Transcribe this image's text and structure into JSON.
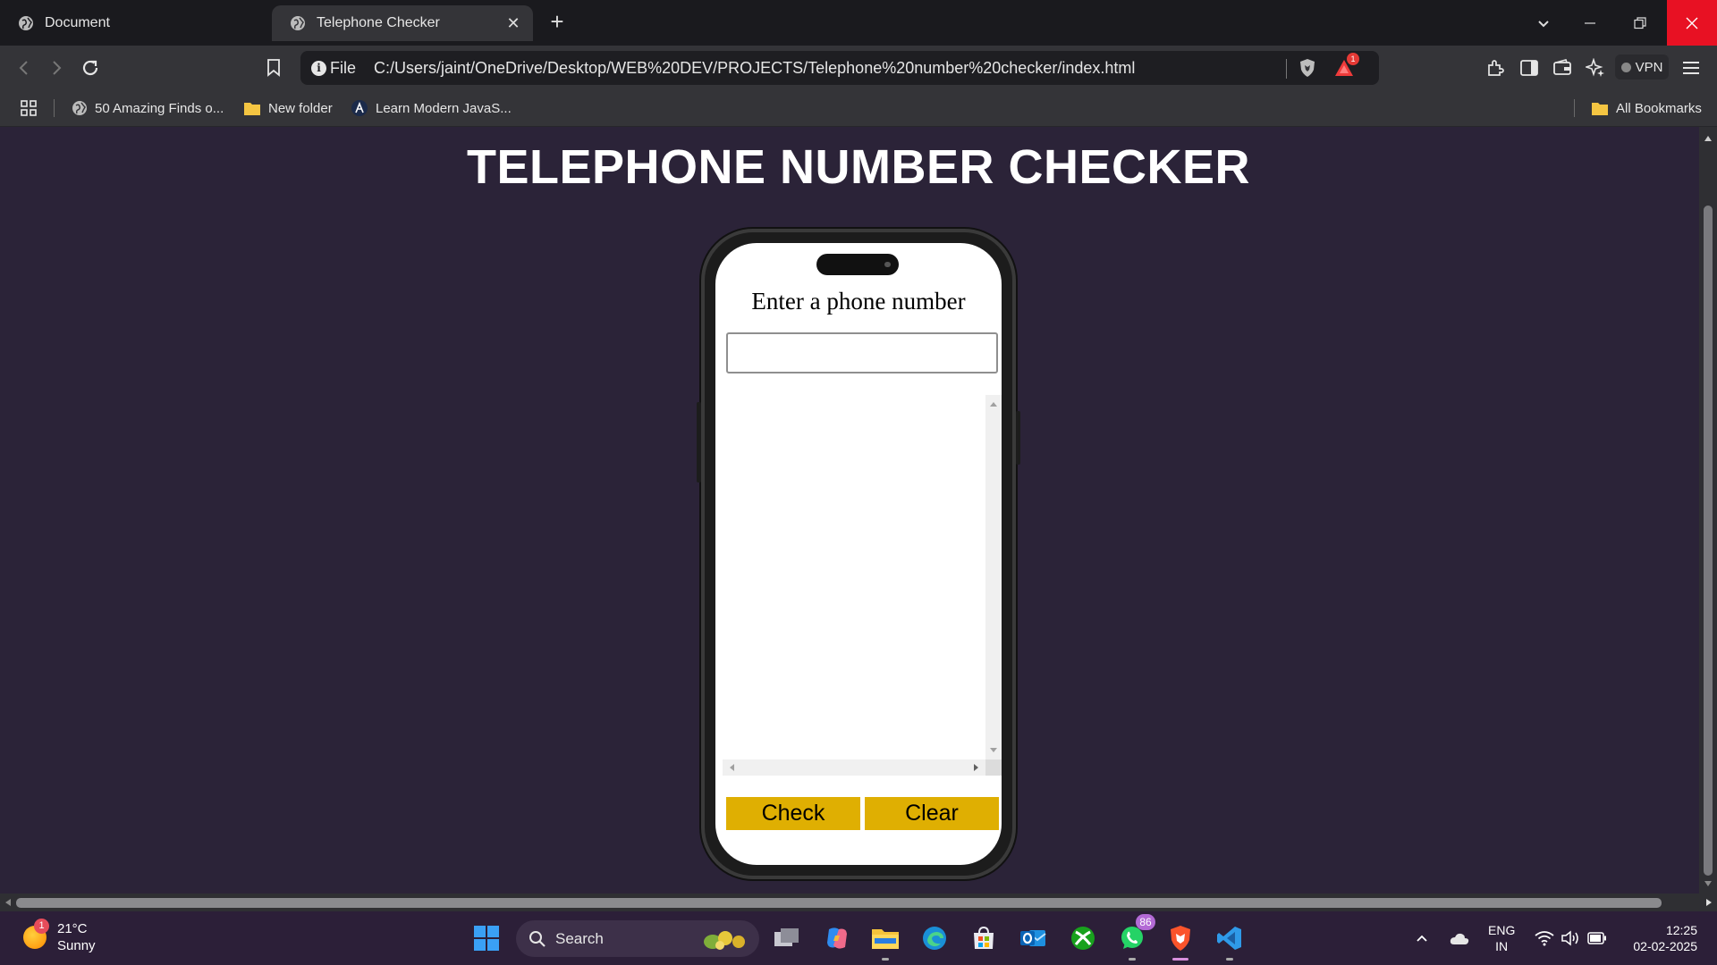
{
  "browser": {
    "tabs": [
      {
        "title": "Document",
        "active": false
      },
      {
        "title": "Telephone Checker",
        "active": true
      }
    ],
    "address": {
      "scheme_label": "File",
      "url": "C:/Users/jaint/OneDrive/Desktop/WEB%20DEV/PROJECTS/Telephone%20number%20checker/index.html"
    },
    "alerts_badge": "1",
    "vpn_label": "VPN",
    "bookmarks": [
      {
        "label": "50 Amazing Finds o...",
        "icon": "globe-icon"
      },
      {
        "label": "New folder",
        "icon": "folder-icon"
      },
      {
        "label": "Learn Modern JavaS...",
        "icon": "site-icon"
      }
    ],
    "all_bookmarks_label": "All Bookmarks"
  },
  "page": {
    "title": "TELEPHONE NUMBER CHECKER",
    "input_label": "Enter a phone number",
    "input_value": "",
    "check_button": "Check",
    "clear_button": "Clear",
    "button_color": "#dfaf02",
    "background_color": "#2b2338"
  },
  "taskbar": {
    "weather": {
      "badge": "1",
      "temp": "21°C",
      "condition": "Sunny"
    },
    "search_label": "Search",
    "whatsapp_badge": "86",
    "language": {
      "line1": "ENG",
      "line2": "IN"
    },
    "clock": {
      "time": "12:25",
      "date": "02-02-2025"
    }
  }
}
